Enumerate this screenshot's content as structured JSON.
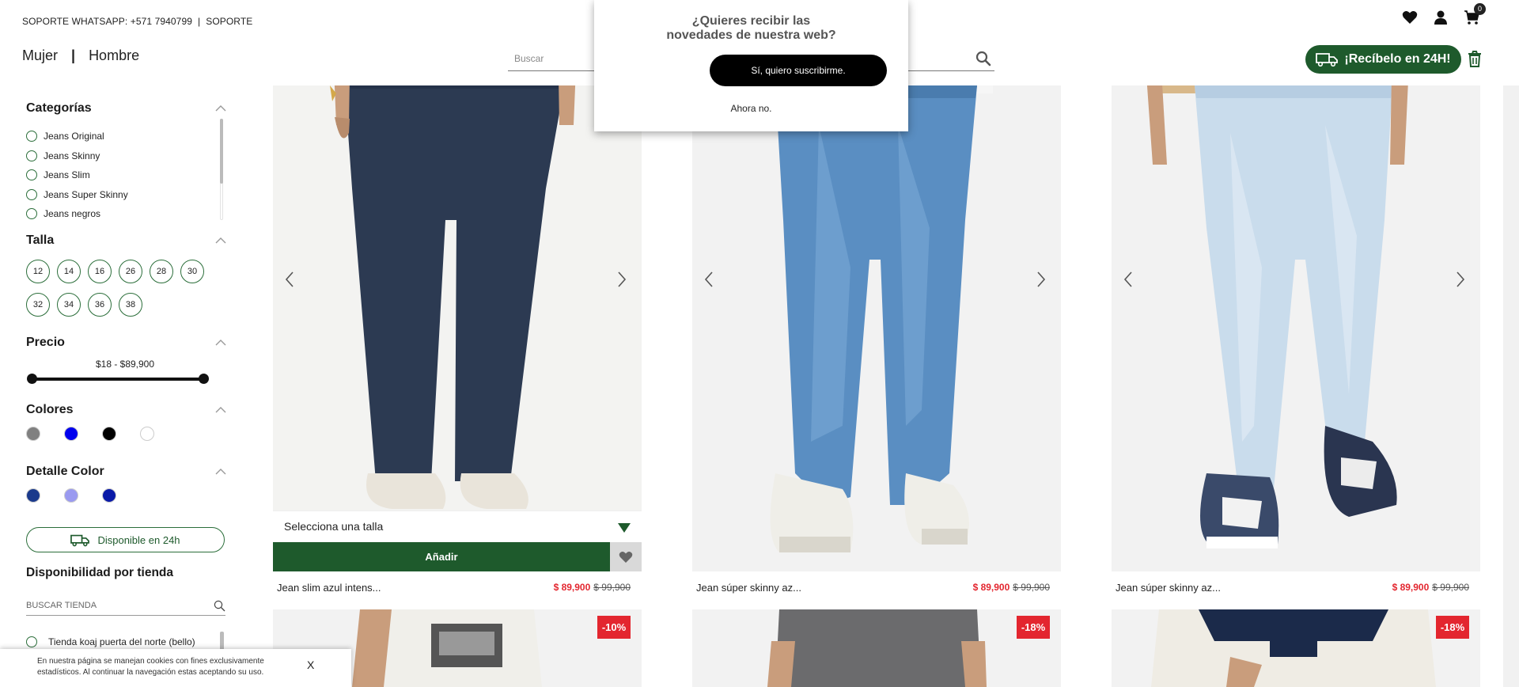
{
  "header": {
    "support_whatsapp": "SOPORTE WHATSAPP: +571 7940799",
    "support_sep": "|",
    "support_link": "SOPORTE",
    "gender_women": "Mujer",
    "gender_sep": "|",
    "gender_men": "Hombre",
    "search_placeholder": "Buscar",
    "cart_count": "0",
    "delivery_button": "¡Recíbelo en 24H!"
  },
  "popup": {
    "title": "¿Quieres recibir las novedades de nuestra web?",
    "accept": "Sí, quiero suscribirme.",
    "decline": "Ahora no."
  },
  "filters": {
    "categories_title": "Categorías",
    "categories": [
      "Jeans Original",
      "Jeans Skinny",
      "Jeans Slim",
      "Jeans Super Skinny",
      "Jeans negros"
    ],
    "size_title": "Talla",
    "sizes_row1": [
      "12",
      "14",
      "16",
      "26",
      "28",
      "30"
    ],
    "sizes_row2": [
      "32",
      "34",
      "36",
      "38"
    ],
    "price_title": "Precio",
    "price_range": "$18 - $89,900",
    "price_range_fraction": [
      0,
      1
    ],
    "colors_title": "Colores",
    "colors": [
      "#808080",
      "#0000ee",
      "#000000",
      "#ffffff"
    ],
    "detail_color_title": "Detalle Color",
    "detail_colors": [
      "#1a3a8c",
      "#9a9af0",
      "#0a1aa8"
    ],
    "available_24h": "Disponible en 24h",
    "store_title": "Disponibilidad por tienda",
    "store_search_placeholder": "BUSCAR TIENDA",
    "stores": [
      "Tienda koaj puerta del norte (bello)"
    ]
  },
  "cookie": {
    "text": "En nuestra página se manejan cookies con fines exclusivamente estadísticos. Al continuar la navegación estas aceptando su uso.",
    "close": "X"
  },
  "products": [
    {
      "name": "Jean slim azul intens...",
      "price": "$ 89,900",
      "old_price": "$ 99,900",
      "size_prompt": "Selecciona una talla",
      "add_label": "Añadir"
    },
    {
      "name": "Jean súper skinny az...",
      "price": "$ 89,900",
      "old_price": "$ 99,900"
    },
    {
      "name": "Jean súper skinny az...",
      "price": "$ 89,900",
      "old_price": "$ 99,900"
    }
  ],
  "next_row_discounts": [
    "-10%",
    "-18%",
    "-18%"
  ],
  "theme": {
    "brand_green": "#1e5a2c",
    "sale_red": "#e3262f"
  }
}
